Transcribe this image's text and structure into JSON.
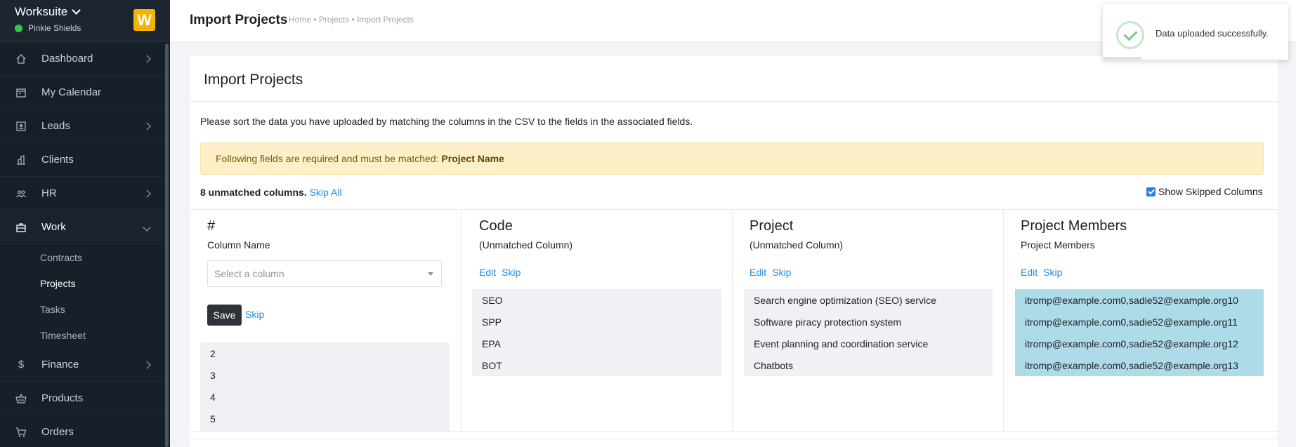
{
  "sidebar": {
    "brand": "Worksuite",
    "user": "Pinkie Shields",
    "logo_letter": "W",
    "items": [
      {
        "label": "Dashboard",
        "icon": "home-icon"
      },
      {
        "label": "My Calendar",
        "icon": "calendar-icon"
      },
      {
        "label": "Leads",
        "icon": "contact-card-icon"
      },
      {
        "label": "Clients",
        "icon": "building-icon"
      },
      {
        "label": "HR",
        "icon": "people-icon"
      },
      {
        "label": "Work",
        "icon": "briefcase-icon"
      },
      {
        "label": "Finance",
        "icon": "dollar-icon"
      },
      {
        "label": "Products",
        "icon": "basket-icon"
      },
      {
        "label": "Orders",
        "icon": "cart-icon"
      }
    ],
    "work_sub": [
      "Contracts",
      "Projects",
      "Tasks",
      "Timesheet"
    ]
  },
  "header": {
    "title": "Import Projects",
    "breadcrumb": "Home • Projects • Import Projects"
  },
  "toast": {
    "message": "Data uploaded successfully."
  },
  "card": {
    "title": "Import Projects",
    "intro": "Please sort the data you have uploaded by matching the columns in the CSV to the fields in the associated fields.",
    "alert_prefix": "Following fields are required and must be matched: ",
    "alert_field": "Project Name",
    "unmatched_count": "8 unmatched columns.",
    "skip_all": "Skip All",
    "show_skipped": "Show Skipped Columns",
    "columns": [
      {
        "heading": "#",
        "subtitle": "Column Name",
        "select_placeholder": "Select a column",
        "save": "Save",
        "skip": "Skip",
        "values": [
          "2",
          "3",
          "4",
          "5"
        ]
      },
      {
        "heading": "Code",
        "subtitle": "(Unmatched Column)",
        "edit": "Edit",
        "skip": "Skip",
        "values": [
          "SEO",
          "SPP",
          "EPA",
          "BOT"
        ]
      },
      {
        "heading": "Project",
        "subtitle": "(Unmatched Column)",
        "edit": "Edit",
        "skip": "Skip",
        "values": [
          "Search engine optimization (SEO) service",
          "Software piracy protection system",
          "Event planning and coordination service",
          "Chatbots"
        ]
      },
      {
        "heading": "Project Members",
        "subtitle": "Project Members",
        "edit": "Edit",
        "skip": "Skip",
        "values": [
          "itromp@example.com0,sadie52@example.org10",
          "itromp@example.com0,sadie52@example.org11",
          "itromp@example.com0,sadie52@example.org12",
          "itromp@example.com0,sadie52@example.org13"
        ]
      }
    ]
  }
}
